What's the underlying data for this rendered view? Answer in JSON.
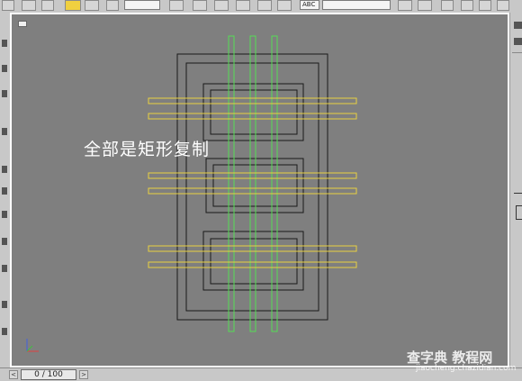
{
  "toolbar": {
    "zoom_field": "",
    "abc_field": "ABC"
  },
  "viewport": {
    "annotation": "全部是矩形复制"
  },
  "timeslider": {
    "frame_label": "0 / 100",
    "prev_label": "<",
    "next_label": ">"
  },
  "watermark": {
    "title": "查字典 教程网",
    "url": "jiaocheng.chazidian.com"
  },
  "colors": {
    "viewport_bg": "#7f7f7f",
    "frame_lines": "#1a1a1a",
    "green_rects": "#55dd55",
    "yellow_rects": "#e8d040"
  }
}
